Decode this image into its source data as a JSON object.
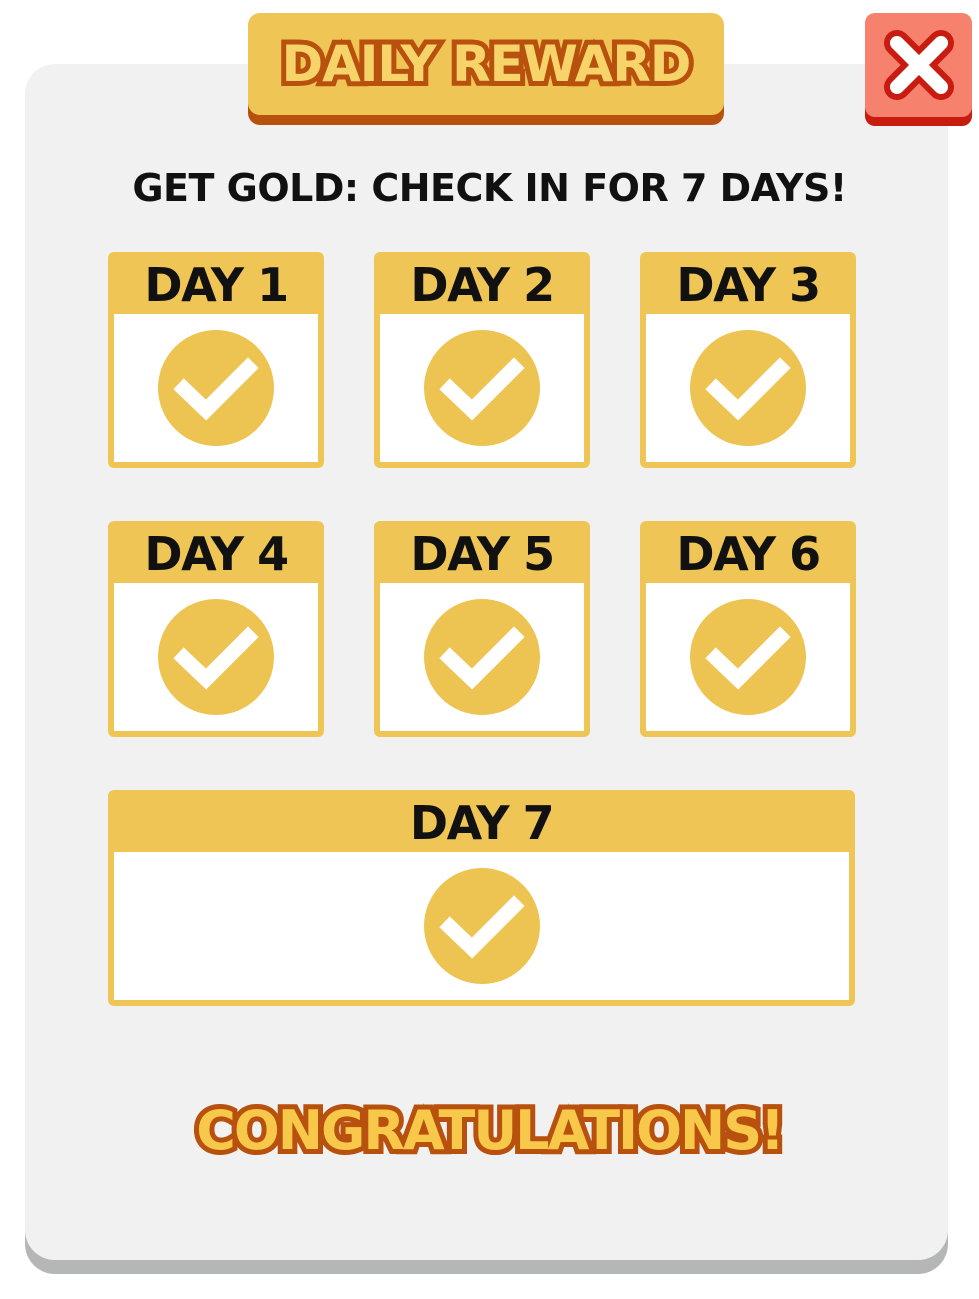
{
  "title": "DAILY REWARD",
  "subtitle": "GET GOLD: CHECK IN FOR 7 DAYS!",
  "days": [
    {
      "label": "DAY 1",
      "checked": true
    },
    {
      "label": "DAY 2",
      "checked": true
    },
    {
      "label": "DAY 3",
      "checked": true
    },
    {
      "label": "DAY 4",
      "checked": true
    },
    {
      "label": "DAY 5",
      "checked": true
    },
    {
      "label": "DAY 6",
      "checked": true
    },
    {
      "label": "DAY 7",
      "checked": true
    }
  ],
  "footer": "CONGRATULATIONS!",
  "icons": {
    "close": "close-icon",
    "check": "check-icon"
  },
  "colors": {
    "panel": "#f0f1f0",
    "accent": "#efc656",
    "title_outline": "#b8500e",
    "close_button": "#f6816c",
    "close_shadow": "#c81c10",
    "check_circle": "#edc451"
  }
}
